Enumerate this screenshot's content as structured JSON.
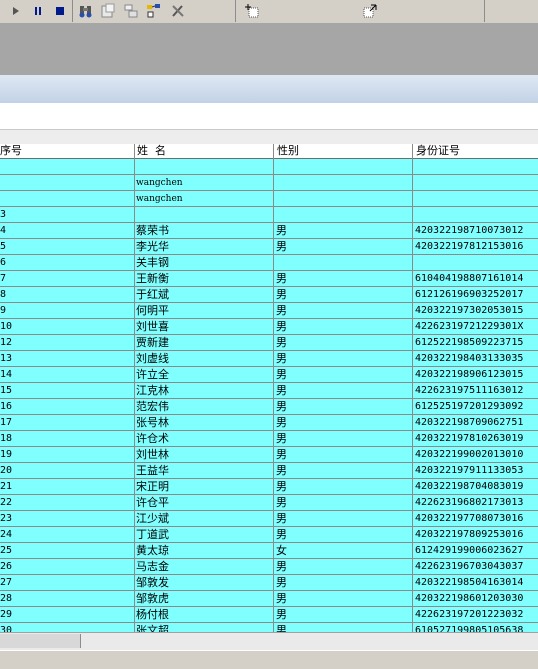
{
  "toolbar": {
    "icons": [
      "play-icon",
      "pause-icon",
      "stop-icon",
      "binoculars-icon",
      "document-props-icon",
      "print-layout-icon",
      "tree-icon",
      "tools-icon",
      "frame-insert-icon",
      "frame-arrow-icon"
    ]
  },
  "grid": {
    "headers": {
      "seq": "序号",
      "name": "姓  名",
      "gender": "性别",
      "id": "身份证号"
    },
    "rows": [
      {
        "seq": "",
        "name": "",
        "gender": "",
        "id": ""
      },
      {
        "seq": "",
        "name": "wangchen",
        "gender": "",
        "id": ""
      },
      {
        "seq": "",
        "name": "wangchen",
        "gender": "",
        "id": ""
      },
      {
        "seq": "3",
        "name": "",
        "gender": "",
        "id": ""
      },
      {
        "seq": "4",
        "name": "蔡荣书",
        "gender": "男",
        "id": "420322198710073012"
      },
      {
        "seq": "5",
        "name": "李光华",
        "gender": "男",
        "id": "420322197812153016"
      },
      {
        "seq": "6",
        "name": "关丰钢",
        "gender": "",
        "id": ""
      },
      {
        "seq": "7",
        "name": "王新衡",
        "gender": "男",
        "id": "610404198807161014"
      },
      {
        "seq": "8",
        "name": "于红斌",
        "gender": "男",
        "id": "612126196903252017"
      },
      {
        "seq": "9",
        "name": "何明平",
        "gender": "男",
        "id": "420322197302053015"
      },
      {
        "seq": "10",
        "name": "刘世喜",
        "gender": "男",
        "id": "42262319721229301X"
      },
      {
        "seq": "12",
        "name": "贾新建",
        "gender": "男",
        "id": "612522198509223715"
      },
      {
        "seq": "13",
        "name": "刘虚线",
        "gender": "男",
        "id": "420322198403133035"
      },
      {
        "seq": "14",
        "name": "许立全",
        "gender": "男",
        "id": "420322198906123015"
      },
      {
        "seq": "15",
        "name": "江克林",
        "gender": "男",
        "id": "422623197511163012"
      },
      {
        "seq": "16",
        "name": "范宏伟",
        "gender": "男",
        "id": "612525197201293092"
      },
      {
        "seq": "17",
        "name": "张号林",
        "gender": "男",
        "id": "420322198709062751"
      },
      {
        "seq": "18",
        "name": "许仓术",
        "gender": "男",
        "id": "420322197810263019"
      },
      {
        "seq": "19",
        "name": "刘世林",
        "gender": "男",
        "id": "420322199002013010"
      },
      {
        "seq": "20",
        "name": "王益华",
        "gender": "男",
        "id": "420322197911133053"
      },
      {
        "seq": "21",
        "name": "宋正明",
        "gender": "男",
        "id": "420322198704083019"
      },
      {
        "seq": "22",
        "name": "许仓平",
        "gender": "男",
        "id": "422623196802173013"
      },
      {
        "seq": "23",
        "name": "江少斌",
        "gender": "男",
        "id": "420322197708073016"
      },
      {
        "seq": "24",
        "name": "丁道武",
        "gender": "男",
        "id": "420322197809253016"
      },
      {
        "seq": "25",
        "name": "黄太琼",
        "gender": "女",
        "id": "612429199006023627"
      },
      {
        "seq": "26",
        "name": "马志金",
        "gender": "男",
        "id": "422623196703043037"
      },
      {
        "seq": "27",
        "name": "邹敦发",
        "gender": "男",
        "id": "420322198504163014"
      },
      {
        "seq": "28",
        "name": "邹敦虎",
        "gender": "男",
        "id": "420322198601203030"
      },
      {
        "seq": "29",
        "name": "杨付根",
        "gender": "男",
        "id": "422623197201223032"
      },
      {
        "seq": "30",
        "name": "张文超",
        "gender": "男",
        "id": "610527199805105638"
      }
    ]
  }
}
